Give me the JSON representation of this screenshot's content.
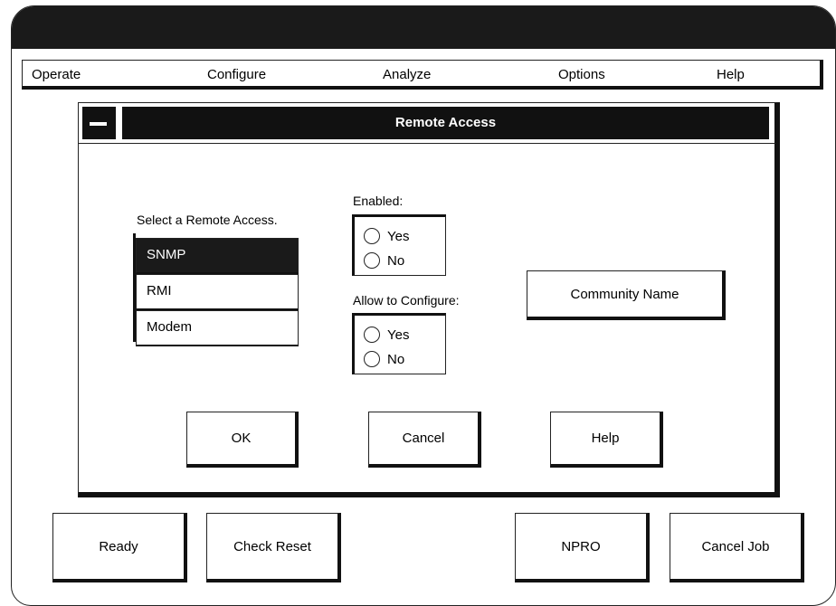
{
  "menubar": {
    "items": [
      {
        "label": "Operate"
      },
      {
        "label": "Configure"
      },
      {
        "label": "Analyze"
      },
      {
        "label": "Options"
      },
      {
        "label": "Help"
      }
    ]
  },
  "dialog": {
    "title": "Remote Access",
    "list_label": "Select a Remote Access.",
    "list_items": [
      {
        "label": "SNMP",
        "selected": true
      },
      {
        "label": "RMI",
        "selected": false
      },
      {
        "label": "Modem",
        "selected": false
      }
    ],
    "enabled": {
      "label": "Enabled:",
      "options": [
        "Yes",
        "No"
      ]
    },
    "allow_configure": {
      "label": "Allow to Configure:",
      "options": [
        "Yes",
        "No"
      ]
    },
    "community_button": "Community Name",
    "buttons": {
      "ok": "OK",
      "cancel": "Cancel",
      "help": "Help"
    }
  },
  "bottom_buttons": {
    "ready": "Ready",
    "check_reset": "Check Reset",
    "npro": "NPRO",
    "cancel_job": "Cancel Job"
  },
  "colors": {
    "dark": "#111111",
    "background": "#ffffff"
  }
}
